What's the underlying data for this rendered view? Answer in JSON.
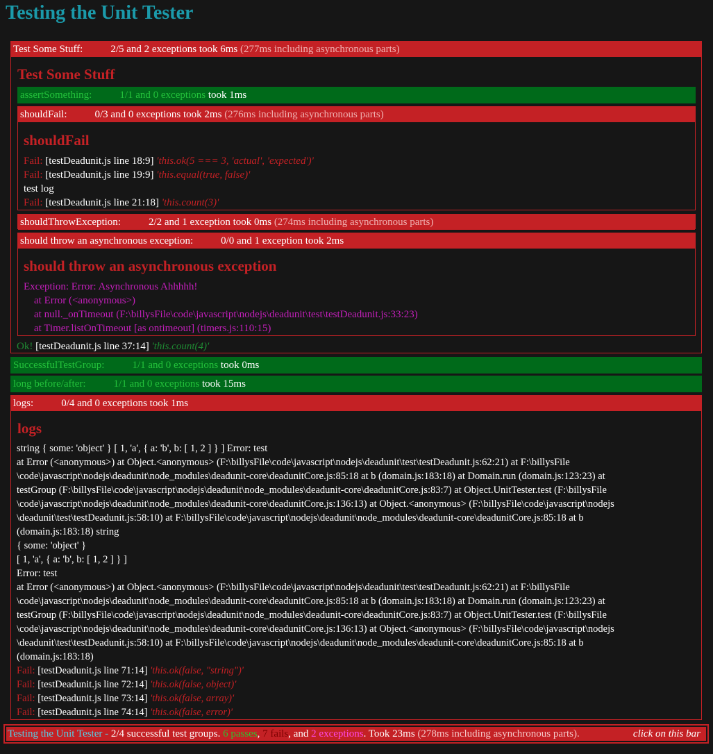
{
  "page": {
    "title": "Testing the Unit Tester"
  },
  "group_main": {
    "bar": {
      "name": "Test Some Stuff:",
      "counts": "2/5 and 2 exceptions",
      "took": "took 6ms",
      "async": "(277ms including asynchronous parts)"
    },
    "title": "Test Some Stuff",
    "assert_something": {
      "name": "assertSomething:",
      "counts": "1/1 and 0 exceptions",
      "took": "took 1ms"
    },
    "should_fail": {
      "bar": {
        "name": "shouldFail:",
        "counts": "0/3 and 0 exceptions",
        "took": "took 2ms",
        "async": "(276ms including asynchronous parts)"
      },
      "title": "shouldFail",
      "results": [
        {
          "label": "Fail:",
          "loc": "[testDeadunit.js line 18:9]",
          "expr": "'this.ok(5 === 3, 'actual', 'expected')'"
        },
        {
          "label": "Fail:",
          "loc": "[testDeadunit.js line 19:9]",
          "expr": "'this.equal(true, false)'"
        },
        {
          "log": "test log"
        },
        {
          "label": "Fail:",
          "loc": "[testDeadunit.js line 21:18]",
          "expr": "'this.count(3)'"
        }
      ]
    },
    "should_throw": {
      "name": "shouldThrowException:",
      "counts": "2/2 and 1 exception",
      "took": "took 0ms",
      "async": "(274ms including asynchronous parts)"
    },
    "async_exception": {
      "bar": {
        "name": "should throw an asynchronous exception:",
        "counts": "0/0 and 1 exception",
        "took": "took 2ms"
      },
      "title": "should throw an asynchronous exception",
      "trace": [
        "Exception: Error: Asynchronous Ahhhhh!",
        "    at Error (<anonymous>)",
        "    at null._onTimeout (F:\\billysFile\\code\\javascript\\nodejs\\deadunit\\test\\testDeadunit.js:33:23)",
        "    at Timer.listOnTimeout [as ontimeout] (timers.js:110:15)"
      ]
    },
    "ok_line": {
      "label": "Ok!",
      "loc": "[testDeadunit.js line 37:14]",
      "expr": "'this.count(4)'"
    }
  },
  "successful_group": {
    "name": "SuccessfulTestGroup:",
    "counts": "1/1 and 0 exceptions",
    "took": "took 0ms"
  },
  "long_group": {
    "name": "long before/after:",
    "counts": "1/1 and 0 exceptions",
    "took": "took 15ms"
  },
  "logs_group": {
    "bar": {
      "name": "logs:",
      "counts": "0/4 and 0 exceptions",
      "took": "took 1ms"
    },
    "title": "logs",
    "lines": [
      "string { some: 'object' } [ 1, 'a', { a: 'b', b: [ 1, 2 ] } ] Error: test",
      "at Error (<anonymous>) at Object.<anonymous> (F:\\billysFile\\code\\javascript\\nodejs\\deadunit\\test\\testDeadunit.js:62:21) at F:\\billysFile",
      "\\code\\javascript\\nodejs\\deadunit\\node_modules\\deadunit-core\\deadunitCore.js:85:18 at b (domain.js:183:18) at Domain.run (domain.js:123:23) at",
      "testGroup (F:\\billysFile\\code\\javascript\\nodejs\\deadunit\\node_modules\\deadunit-core\\deadunitCore.js:83:7) at Object.UnitTester.test (F:\\billysFile",
      "\\code\\javascript\\nodejs\\deadunit\\node_modules\\deadunit-core\\deadunitCore.js:136:13) at Object.<anonymous> (F:\\billysFile\\code\\javascript\\nodejs",
      "\\deadunit\\test\\testDeadunit.js:58:10) at F:\\billysFile\\code\\javascript\\nodejs\\deadunit\\node_modules\\deadunit-core\\deadunitCore.js:85:18 at b",
      "(domain.js:183:18) string",
      "{ some: 'object' }",
      "[ 1, 'a', { a: 'b', b: [ 1, 2 ] } ]",
      "Error: test",
      "at Error (<anonymous>) at Object.<anonymous> (F:\\billysFile\\code\\javascript\\nodejs\\deadunit\\test\\testDeadunit.js:62:21) at F:\\billysFile",
      "\\code\\javascript\\nodejs\\deadunit\\node_modules\\deadunit-core\\deadunitCore.js:85:18 at b (domain.js:183:18) at Domain.run (domain.js:123:23) at",
      "testGroup (F:\\billysFile\\code\\javascript\\nodejs\\deadunit\\node_modules\\deadunit-core\\deadunitCore.js:83:7) at Object.UnitTester.test (F:\\billysFile",
      "\\code\\javascript\\nodejs\\deadunit\\node_modules\\deadunit-core\\deadunitCore.js:136:13) at Object.<anonymous> (F:\\billysFile\\code\\javascript\\nodejs",
      "\\deadunit\\test\\testDeadunit.js:58:10) at F:\\billysFile\\code\\javascript\\nodejs\\deadunit\\node_modules\\deadunit-core\\deadunitCore.js:85:18 at b",
      "(domain.js:183:18)"
    ],
    "fails": [
      {
        "label": "Fail:",
        "loc": "[testDeadunit.js line 71:14]",
        "expr": "'this.ok(false, \"string\")'"
      },
      {
        "label": "Fail:",
        "loc": "[testDeadunit.js line 72:14]",
        "expr": "'this.ok(false, object)'"
      },
      {
        "label": "Fail:",
        "loc": "[testDeadunit.js line 73:14]",
        "expr": "'this.ok(false, array)'"
      },
      {
        "label": "Fail:",
        "loc": "[testDeadunit.js line 74:14]",
        "expr": "'this.ok(false, error)'"
      }
    ]
  },
  "footer": {
    "name": "Testing the Unit Tester",
    "dash": " - ",
    "groups": "2/4 successful test groups. ",
    "passes": "6 passes",
    "comma1": ", ",
    "fails": "7 fails",
    "and": ", and ",
    "exceptions": "2 exceptions",
    "took": ". Took 23ms ",
    "async": "(278ms including asynchronous parts).",
    "hint": "click on this bar"
  },
  "colors": {
    "fail": "#c42125",
    "pass": "#006a1a",
    "title": "#1b9aaa",
    "exception": "#c41fbb"
  }
}
